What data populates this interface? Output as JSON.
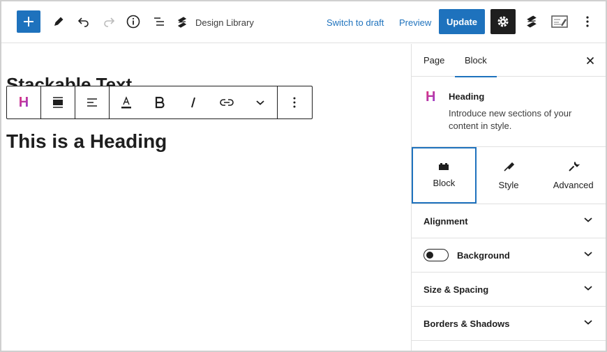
{
  "topbar": {
    "add_icon": "plus-icon",
    "doc_title": "Design Library",
    "switch_to_draft": "Switch to draft",
    "preview": "Preview",
    "update": "Update",
    "accent_color": "#1e72bd"
  },
  "canvas": {
    "hidden_heading": "Stackable Text",
    "toolbar_block_icon": "H",
    "heading": "This is a Heading"
  },
  "sidebar": {
    "tabs": [
      {
        "label": "Page"
      },
      {
        "label": "Block"
      }
    ],
    "block_icon": "H",
    "block_title": "Heading",
    "block_description": "Introduce new sections of your content in style.",
    "modes": [
      {
        "label": "Block"
      },
      {
        "label": "Style"
      },
      {
        "label": "Advanced"
      }
    ],
    "panels": [
      {
        "label": "Alignment"
      },
      {
        "label": "Background"
      },
      {
        "label": "Size & Spacing"
      },
      {
        "label": "Borders & Shadows"
      }
    ]
  }
}
